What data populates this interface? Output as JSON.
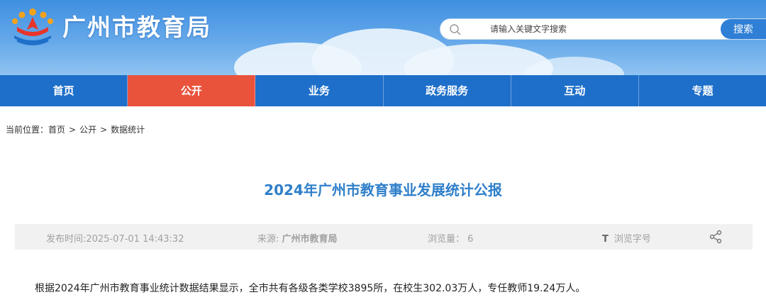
{
  "header": {
    "site_title": "广州市教育局",
    "search": {
      "placeholder": "请输入关键文字搜索",
      "button_label": "搜索"
    }
  },
  "nav": {
    "items": [
      "首页",
      "公开",
      "业务",
      "政务服务",
      "互动",
      "专题"
    ],
    "active_index": 1
  },
  "breadcrumb": {
    "prefix": "当前位置：",
    "items": [
      "首页",
      "公开",
      "数据统计"
    ],
    "separator": ">"
  },
  "article": {
    "title": "2024年广州市教育事业发展统计公报",
    "meta": {
      "publish_label": "发布时间:",
      "publish_time": "2025-07-01 14:43:32",
      "source_label": "来源:",
      "source": "广州市教育局",
      "views_label": "浏览量：",
      "views": "6",
      "font_icon_glyph": "T",
      "font_size_label": "浏览字号"
    },
    "body": "根据2024年广州市教育事业统计数据结果显示，全市共有各级各类学校3895所，在校生302.03万人，专任教师19.24万人。"
  },
  "colors": {
    "header_blue": "#3f8fe0",
    "nav_blue": "#1e6fc9",
    "nav_active": "#e9533c",
    "title_blue": "#2f7fc9",
    "meta_bg": "#f1f1f1"
  },
  "icons": {
    "logo": "education-bureau-logo",
    "search": "search-icon",
    "share": "share-icon"
  }
}
